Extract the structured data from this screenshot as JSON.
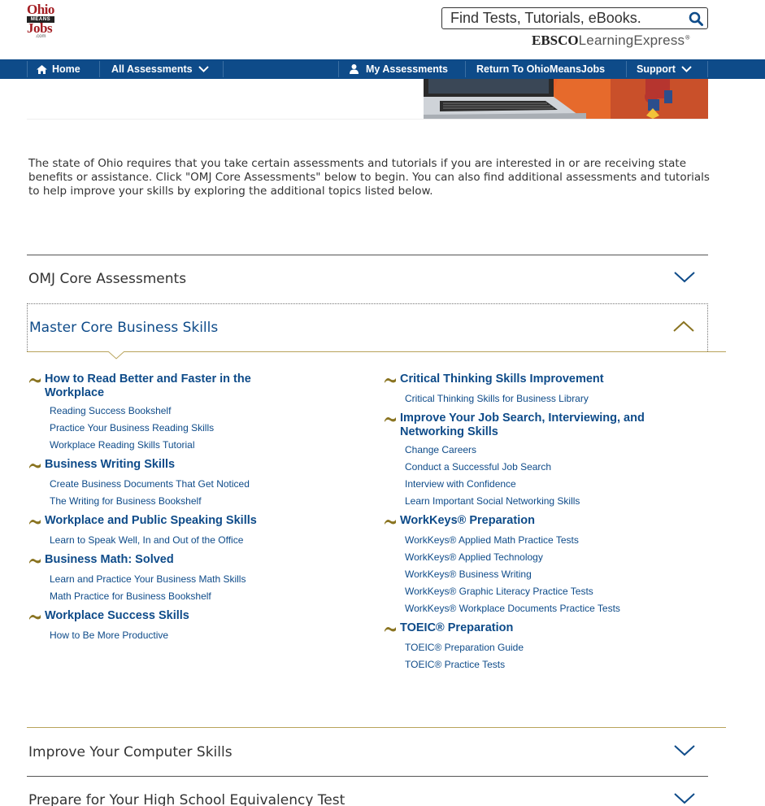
{
  "logo": {
    "line1": "Ohio",
    "line2": "MEANS",
    "line3": "Jobs",
    "line4": ".com"
  },
  "search": {
    "placeholder": "Find Tests, Tutorials, eBooks."
  },
  "brand": {
    "ebsco": "EBSCO",
    "learning_express": "LearningExpress",
    "reg": "®"
  },
  "nav": {
    "home": "Home",
    "all_assessments": "All Assessments",
    "my_assessments": "My Assessments",
    "return": "Return To OhioMeansJobs",
    "support": "Support"
  },
  "intro": "The state of Ohio requires that you take certain assessments and tutorials if you are interested in or are receiving state benefits or assistance. Click \"OMJ Core Assessments\" below to begin. You can also find additional assessments and tutorials to help improve your skills by exploring the additional topics listed below.",
  "accordion": {
    "omj_core": "OMJ Core Assessments",
    "master_core": "Master Core Business Skills",
    "computer_skills": "Improve Your Computer Skills",
    "high_school": "Prepare for Your High School Equivalency Test"
  },
  "left_groups": [
    {
      "title": "How to Read Better and Faster in the Workplace",
      "links": [
        "Reading Success Bookshelf",
        "Practice Your Business Reading Skills",
        "Workplace Reading Skills Tutorial"
      ]
    },
    {
      "title": "Business Writing Skills",
      "links": [
        "Create Business Documents That Get Noticed",
        "The Writing for Business Bookshelf"
      ]
    },
    {
      "title": "Workplace and Public Speaking Skills",
      "links": [
        "Learn to Speak Well, In and Out of the Office"
      ]
    },
    {
      "title": "Business Math: Solved",
      "links": [
        "Learn and Practice Your Business Math Skills",
        "Math Practice for Business Bookshelf"
      ]
    },
    {
      "title": "Workplace Success Skills",
      "links": [
        "How to Be More Productive"
      ]
    }
  ],
  "right_groups": [
    {
      "title": "Critical Thinking Skills Improvement",
      "links": [
        "Critical Thinking Skills for Business Library"
      ]
    },
    {
      "title": "Improve Your Job Search, Interviewing, and Networking Skills",
      "links": [
        "Change Careers",
        "Conduct a Successful Job Search",
        "Interview with Confidence",
        "Learn Important Social Networking Skills"
      ]
    },
    {
      "title": "WorkKeys® Preparation",
      "links": [
        "WorkKeys® Applied Math Practice Tests",
        "WorkKeys® Applied Technology",
        "WorkKeys® Business Writing",
        "WorkKeys® Graphic Literacy Practice Tests",
        "WorkKeys® Workplace Documents Practice Tests"
      ]
    },
    {
      "title": "TOEIC® Preparation",
      "links": [
        "TOEIC® Preparation Guide",
        "TOEIC® Practice Tests"
      ]
    }
  ],
  "colors": {
    "nav": "#0e4b89",
    "link": "#0e4b89",
    "accent": "#8a7421",
    "logo_red": "#a41e23"
  }
}
